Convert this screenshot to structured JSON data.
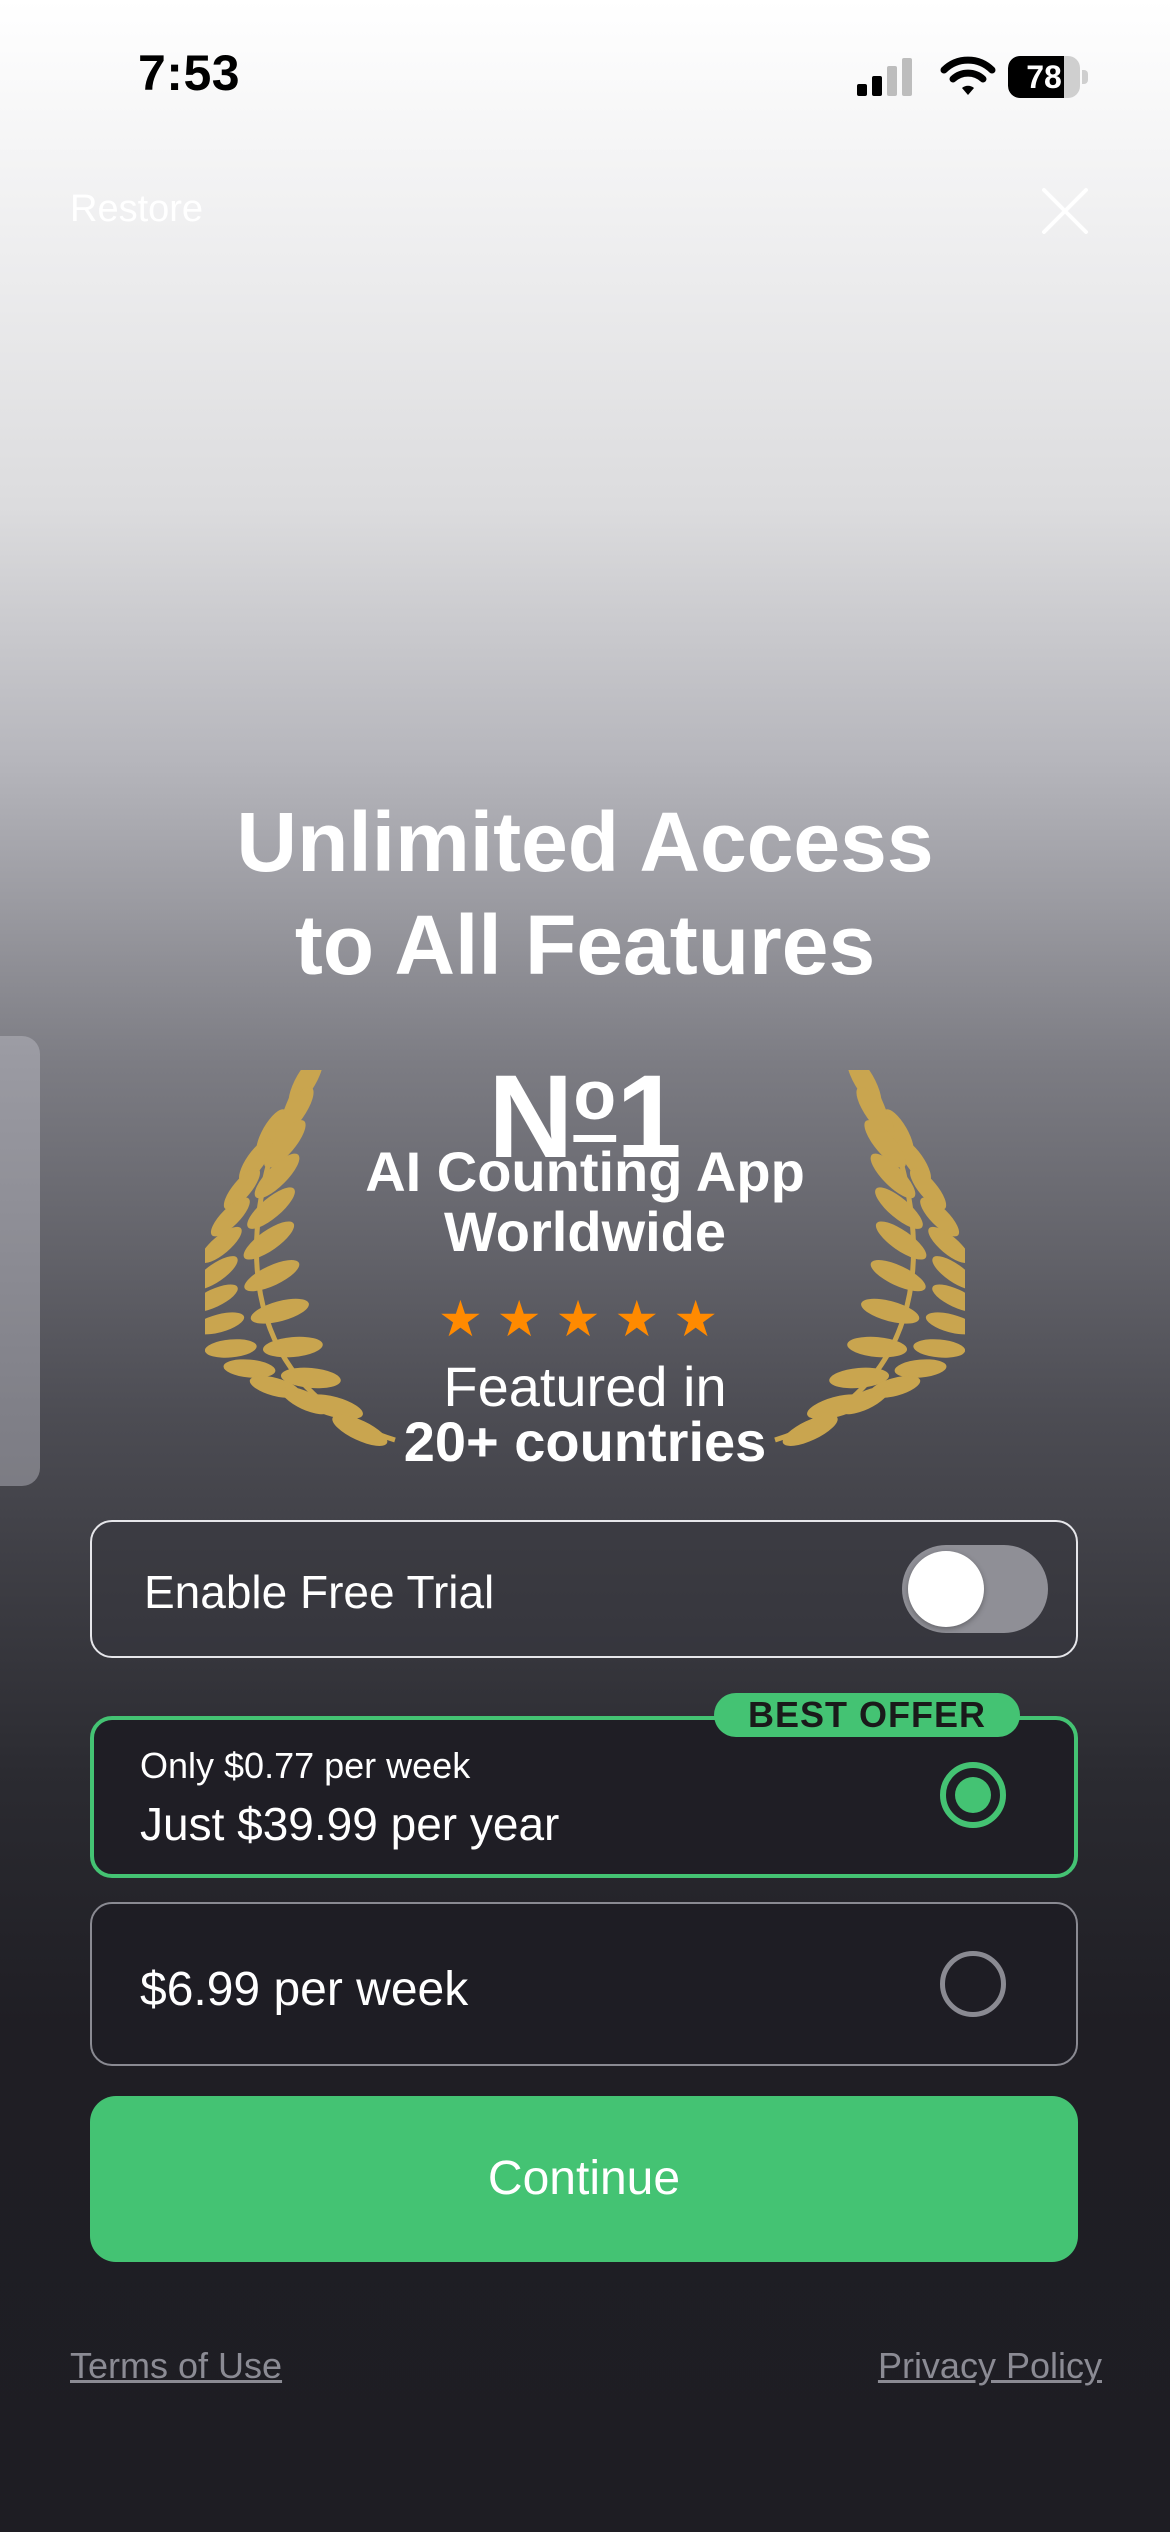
{
  "status_bar": {
    "time": "7:53",
    "battery_level": "78",
    "icons": [
      "cellular-signal-icon",
      "wifi-icon",
      "battery-icon"
    ]
  },
  "header": {
    "restore_label": "Restore",
    "close_icon": "close-icon"
  },
  "headline": {
    "line1": "Unlimited Access",
    "line2": "to All Features"
  },
  "award": {
    "rank_main": "N",
    "rank_sup": "o",
    "rank_number": "1",
    "line1": "AI Counting App",
    "line2": "Worldwide",
    "stars": "★★★★★",
    "star_rating": 5,
    "featured_line1": "Featured in",
    "featured_line2": "20+ countries",
    "laurel_icon": "laurel-wreath-icon"
  },
  "trial": {
    "label": "Enable Free Trial",
    "enabled": false
  },
  "plans": [
    {
      "badge": "BEST OFFER",
      "subtitle": "Only $0.77 per week",
      "title": "Just $39.99 per year",
      "selected": true
    },
    {
      "title": "$6.99 per week",
      "selected": false
    }
  ],
  "continue_label": "Continue",
  "footer": {
    "terms_label": "Terms of Use",
    "privacy_label": "Privacy Policy"
  },
  "colors": {
    "accent": "#44c373",
    "star": "#ff8a00",
    "laurel": "#c9a54f",
    "background_dark": "#1e1d23"
  }
}
